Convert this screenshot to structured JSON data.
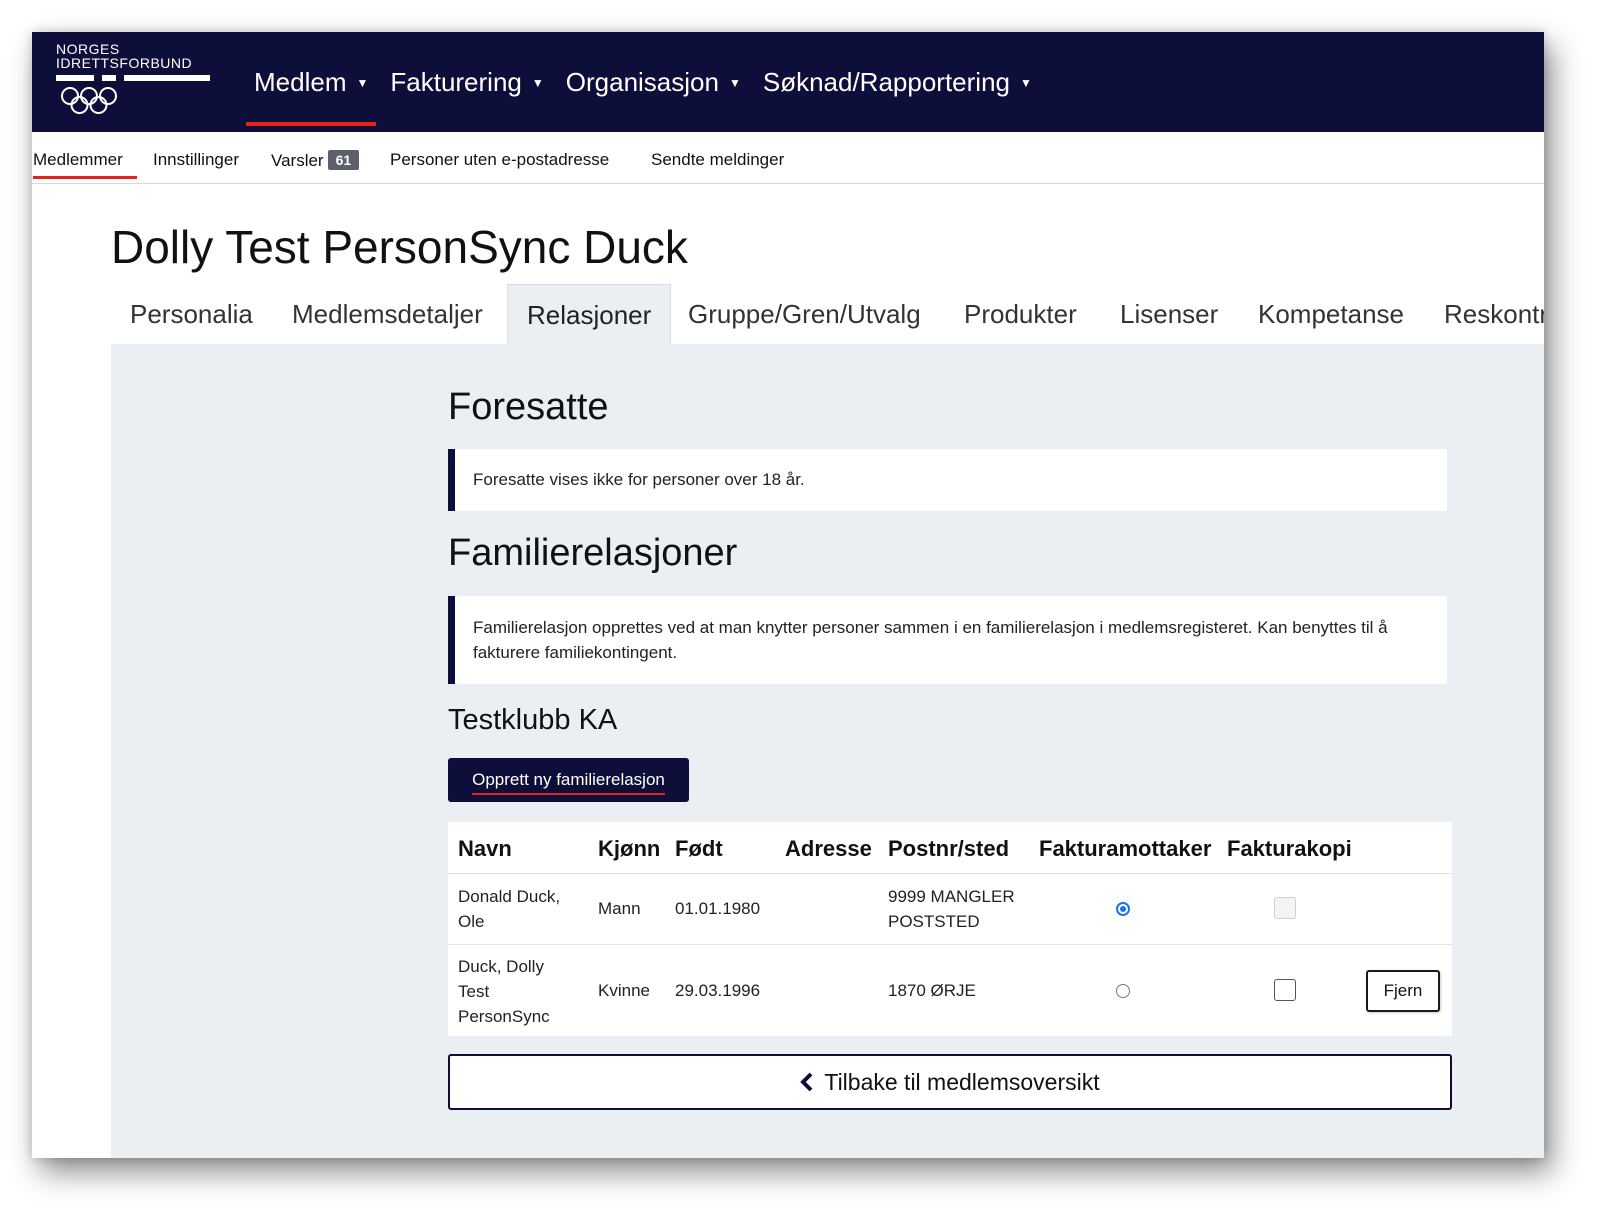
{
  "brand": {
    "line1": "NORGES",
    "line2": "IDRETTSFORBUND"
  },
  "main_nav": [
    {
      "label": "Medlem",
      "active": true
    },
    {
      "label": "Fakturering",
      "active": false
    },
    {
      "label": "Organisasjon",
      "active": false
    },
    {
      "label": "Søknad/Rapportering",
      "active": false
    }
  ],
  "sub_nav": {
    "members": "Medlemmer",
    "settings": "Innstillinger",
    "alerts": "Varsler",
    "alerts_count": "61",
    "no_email": "Personer uten e-postadresse",
    "sent": "Sendte meldinger"
  },
  "page_title": "Dolly Test PersonSync Duck",
  "tabs": [
    {
      "label": "Personalia",
      "active": false
    },
    {
      "label": "Medlemsdetaljer",
      "active": false
    },
    {
      "label": "Relasjoner",
      "active": true
    },
    {
      "label": "Gruppe/Gren/Utvalg",
      "active": false
    },
    {
      "label": "Produkter",
      "active": false
    },
    {
      "label": "Lisenser",
      "active": false
    },
    {
      "label": "Kompetanse",
      "active": false
    },
    {
      "label": "Reskontro",
      "active": false
    }
  ],
  "guardians": {
    "title": "Foresatte",
    "info": "Foresatte vises ikke for personer over 18 år."
  },
  "family": {
    "title": "Familierelasjoner",
    "info": "Familierelasjon opprettes ved at man knytter personer sammen i en familierelasjon i medlemsregisteret. Kan benyttes til å fakturere familiekontingent.",
    "club": "Testklubb KA",
    "create_button": "Opprett ny familierelasjon"
  },
  "table": {
    "headers": {
      "name": "Navn",
      "gender": "Kjønn",
      "born": "Født",
      "address": "Adresse",
      "postal": "Postnr/sted",
      "invoice_recipient": "Fakturamottaker",
      "invoice_copy": "Fakturakopi"
    },
    "rows": [
      {
        "name": "Donald Duck, Ole",
        "gender": "Mann",
        "born": "01.01.1980",
        "address": "",
        "postal": "9999 MANGLER POSTSTED",
        "invoice_recipient": true,
        "invoice_copy": false,
        "invoice_copy_disabled": true
      },
      {
        "name": "Duck, Dolly Test PersonSync",
        "gender": "Kvinne",
        "born": "29.03.1996",
        "address": "",
        "postal": "1870 ØRJE",
        "invoice_recipient": false,
        "invoice_copy": false,
        "invoice_copy_disabled": false,
        "remove_label": "Fjern"
      }
    ]
  },
  "back_button": "Tilbake til medlemsoversikt",
  "colors": {
    "navbar": "#0e0e3a",
    "accent_red": "#e2231a",
    "panel": "#e9eff3",
    "radio_blue": "#1a73e8"
  }
}
